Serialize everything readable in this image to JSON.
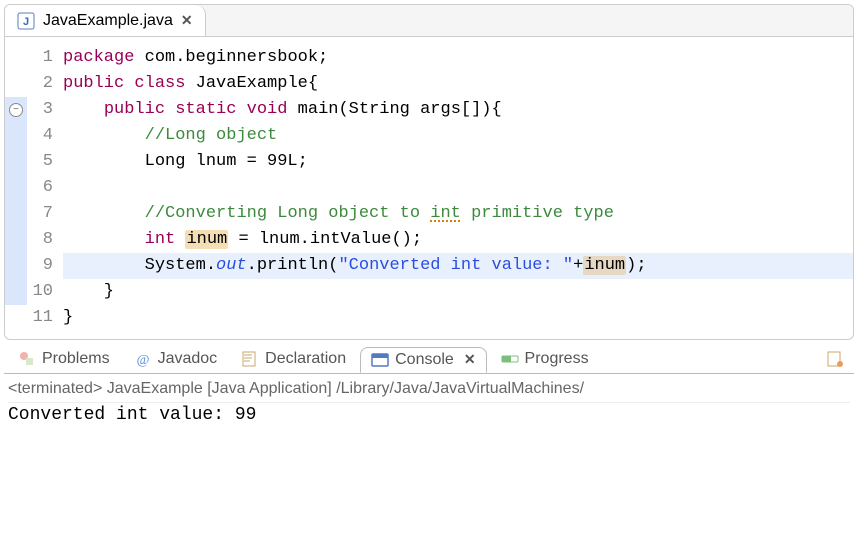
{
  "editor": {
    "tab_filename": "JavaExample.java",
    "lines": [
      {
        "n": 1,
        "marker": "",
        "tokens": [
          [
            "kw",
            "package"
          ],
          [
            "",
            " com.beginnersbook;"
          ]
        ]
      },
      {
        "n": 2,
        "marker": "",
        "tokens": [
          [
            "kw",
            "public"
          ],
          [
            "",
            " "
          ],
          [
            "kw",
            "class"
          ],
          [
            "",
            " JavaExample{"
          ]
        ]
      },
      {
        "n": 3,
        "marker": "fold",
        "markerBlue": true,
        "tokens": [
          [
            "",
            "    "
          ],
          [
            "kw",
            "public"
          ],
          [
            "",
            " "
          ],
          [
            "kw",
            "static"
          ],
          [
            "",
            " "
          ],
          [
            "kw",
            "void"
          ],
          [
            "",
            " main(String args[]){"
          ]
        ]
      },
      {
        "n": 4,
        "marker": "",
        "markerBlue": true,
        "tokens": [
          [
            "",
            "        "
          ],
          [
            "cm",
            "//Long object"
          ]
        ]
      },
      {
        "n": 5,
        "marker": "",
        "markerBlue": true,
        "tokens": [
          [
            "",
            "        Long lnum = 99L;"
          ]
        ]
      },
      {
        "n": 6,
        "marker": "",
        "markerBlue": true,
        "tokens": []
      },
      {
        "n": 7,
        "marker": "",
        "markerBlue": true,
        "tokens": [
          [
            "",
            "        "
          ],
          [
            "cm",
            "//Converting Long object to "
          ],
          [
            "cm underline-err",
            "int"
          ],
          [
            "cm",
            " primitive type"
          ]
        ]
      },
      {
        "n": 8,
        "marker": "",
        "markerBlue": true,
        "tokens": [
          [
            "",
            "        "
          ],
          [
            "kw",
            "int"
          ],
          [
            "",
            " "
          ],
          [
            "box1",
            "inum"
          ],
          [
            "",
            " = lnum.intValue();"
          ]
        ]
      },
      {
        "n": 9,
        "marker": "",
        "markerBlue": true,
        "highlight": true,
        "tokens": [
          [
            "",
            "        System."
          ],
          [
            "fld",
            "out"
          ],
          [
            "",
            ".println("
          ],
          [
            "str",
            "\"Converted int value: \""
          ],
          [
            "",
            "+"
          ],
          [
            "box2",
            "inum"
          ],
          [
            "",
            ");"
          ]
        ]
      },
      {
        "n": 10,
        "marker": "",
        "markerBlue": true,
        "tokens": [
          [
            "",
            "    }"
          ]
        ]
      },
      {
        "n": 11,
        "marker": "",
        "tokens": [
          [
            "",
            "}"
          ]
        ]
      }
    ]
  },
  "bottom": {
    "tabs": {
      "problems": "Problems",
      "javadoc": "Javadoc",
      "declaration": "Declaration",
      "console": "Console",
      "progress": "Progress"
    },
    "console_header": "<terminated> JavaExample [Java Application] /Library/Java/JavaVirtualMachines/",
    "console_output": "Converted int value: 99"
  }
}
